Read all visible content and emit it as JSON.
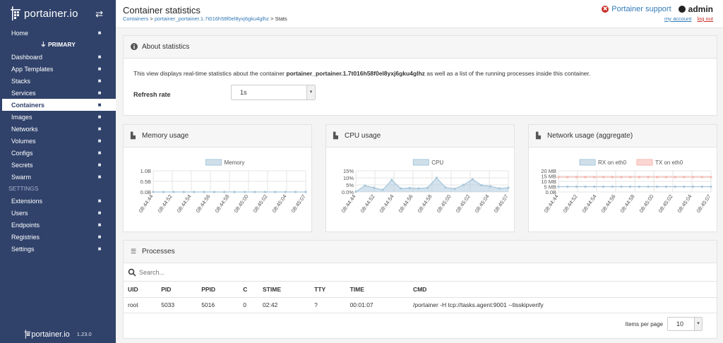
{
  "sidebar": {
    "brand": "portainer.io",
    "items_top": [
      {
        "label": "Home",
        "icon": "home-icon"
      }
    ],
    "endpoint": "PRIMARY",
    "items": [
      {
        "label": "Dashboard",
        "icon": "dashboard-icon"
      },
      {
        "label": "App Templates",
        "icon": "rocket-icon"
      },
      {
        "label": "Stacks",
        "icon": "list-icon"
      },
      {
        "label": "Services",
        "icon": "services-icon"
      },
      {
        "label": "Containers",
        "icon": "server-icon",
        "active": true
      },
      {
        "label": "Images",
        "icon": "clone-icon"
      },
      {
        "label": "Networks",
        "icon": "sitemap-icon"
      },
      {
        "label": "Volumes",
        "icon": "cubes-icon"
      },
      {
        "label": "Configs",
        "icon": "file-icon"
      },
      {
        "label": "Secrets",
        "icon": "user-secret-icon"
      },
      {
        "label": "Swarm",
        "icon": "object-group-icon"
      }
    ],
    "settings_header": "SETTINGS",
    "settings_items": [
      {
        "label": "Extensions",
        "icon": "bolt-icon"
      },
      {
        "label": "Users",
        "icon": "users-icon"
      },
      {
        "label": "Endpoints",
        "icon": "plug-icon"
      },
      {
        "label": "Registries",
        "icon": "database-icon"
      },
      {
        "label": "Settings",
        "icon": "cogs-icon"
      }
    ],
    "footer_brand": "portainer.io",
    "version": "1.23.0"
  },
  "header": {
    "title": "Container statistics",
    "breadcrumb_1": "Containers",
    "breadcrumb_2": "portainer_portainer.1.7t016h58f0el8yxj6gku4glhz",
    "breadcrumb_3": "Stats",
    "support": "Portainer support",
    "user": "admin",
    "my_account": "my account",
    "logout": "log out"
  },
  "about": {
    "title": "About statistics",
    "text_before": "This view displays real-time statistics about the container ",
    "container_name": "portainer_portainer.1.7t016h58f0el8yxj6gku4glhz",
    "text_after": " as well as a list of the running processes inside this container.",
    "refresh_label": "Refresh rate",
    "refresh_value": "1s"
  },
  "memory_widget": {
    "title": "Memory usage"
  },
  "cpu_widget": {
    "title": "CPU usage"
  },
  "network_widget": {
    "title": "Network usage (aggregate)"
  },
  "chart_data": [
    {
      "type": "line",
      "legend": [
        "Memory"
      ],
      "x": [
        "08:44:44",
        "08:44:52",
        "08:44:54",
        "08:44:56",
        "08:44:58",
        "08:45:00",
        "08:45:02",
        "08:45:04",
        "08:45:07"
      ],
      "y_ticks": [
        "1.0B",
        "0.5B",
        "0.0B"
      ],
      "ylim": [
        0,
        1
      ],
      "series": [
        {
          "name": "Memory",
          "values": [
            0,
            0,
            0,
            0,
            0,
            0,
            0,
            0,
            0,
            0,
            0,
            0,
            0,
            0,
            0,
            0
          ],
          "color": "#a7c6db"
        }
      ]
    },
    {
      "type": "area",
      "legend": [
        "CPU"
      ],
      "x": [
        "08:44:44",
        "08:44:52",
        "08:44:54",
        "08:44:56",
        "08:44:58",
        "08:45:00",
        "08:45:02",
        "08:45:04",
        "08:45:07"
      ],
      "y_ticks": [
        "15%",
        "10%",
        "5%",
        "0.0%"
      ],
      "ylim": [
        0,
        15
      ],
      "series": [
        {
          "name": "CPU",
          "values": [
            0.2,
            4.5,
            3.0,
            1.5,
            8.5,
            2.5,
            2.8,
            2.5,
            3.0,
            10.0,
            3.2,
            2.2,
            5.0,
            9.0,
            4.8,
            4.0,
            2.5,
            3.0
          ],
          "color": "#a7c6db"
        }
      ]
    },
    {
      "type": "line",
      "legend": [
        "RX on eth0",
        "TX on eth0"
      ],
      "x": [
        "08:44:44",
        "08:44:52",
        "08:44:54",
        "08:44:56",
        "08:44:58",
        "08:45:00",
        "08:45:02",
        "08:45:04",
        "08:45:07"
      ],
      "y_ticks": [
        "20 MB",
        "15 MB",
        "10 MB",
        "5 MB",
        "0.0B"
      ],
      "ylim": [
        0,
        20
      ],
      "series": [
        {
          "name": "RX on eth0",
          "values": [
            5,
            5,
            5,
            5,
            5,
            5,
            5,
            5,
            5,
            5,
            5,
            5,
            5,
            5,
            5,
            5,
            5,
            5
          ],
          "color": "#a7c6db"
        },
        {
          "name": "TX on eth0",
          "values": [
            14,
            14,
            14,
            14,
            14,
            14,
            14,
            14,
            14,
            14,
            14,
            14,
            14,
            14,
            14,
            14,
            14,
            14
          ],
          "color": "#f7b6ad"
        }
      ]
    }
  ],
  "processes": {
    "title": "Processes",
    "search_placeholder": "Search...",
    "columns": [
      "UID",
      "PID",
      "PPID",
      "C",
      "STIME",
      "TTY",
      "TIME",
      "CMD"
    ],
    "rows": [
      [
        "root",
        "5033",
        "5016",
        "0",
        "02:42",
        "?",
        "00:01:07",
        "/portainer -H tcp://tasks.agent:9001 --tlsskipverify"
      ]
    ],
    "items_per_page_label": "Items per page",
    "items_per_page": "10"
  },
  "colors": {
    "sidebar": "#30426a",
    "link": "#337ab7",
    "danger": "#c9302c"
  }
}
